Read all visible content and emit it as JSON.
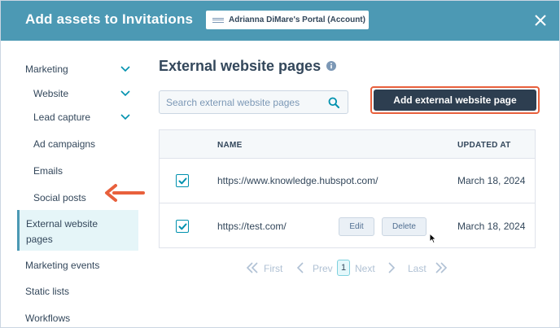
{
  "header": {
    "title": "Add assets to Invitations",
    "account": "Adrianna DiMare's Portal (Account)"
  },
  "sidebar": {
    "items": [
      {
        "label": "Marketing",
        "expanded": true
      },
      {
        "label": "Website"
      },
      {
        "label": "Lead capture"
      },
      {
        "label": "Ad campaigns"
      },
      {
        "label": "Emails"
      },
      {
        "label": "Social posts"
      },
      {
        "label_line1": "External website",
        "label_line2": "pages",
        "active": true
      },
      {
        "label": "Marketing events"
      },
      {
        "label": "Static lists"
      },
      {
        "label": "Workflows"
      }
    ]
  },
  "main": {
    "title": "External website pages",
    "search_placeholder": "Search external website pages",
    "add_button": "Add external website page"
  },
  "table": {
    "columns": [
      "NAME",
      "UPDATED AT"
    ],
    "rows": [
      {
        "name": "https://www.knowledge.hubspot.com/",
        "updated": "March 18, 2024",
        "checked": true
      },
      {
        "name": "https://test.com/",
        "updated": "March 18, 2024",
        "checked": true,
        "edit": "Edit",
        "delete": "Delete"
      }
    ]
  },
  "pagination": {
    "first": "First",
    "prev": "Prev",
    "current": "1",
    "next": "Next",
    "last": "Last"
  },
  "colors": {
    "header_bg": "#4c99b4",
    "primary_dark": "#2d3e50",
    "highlight_orange": "#e8603c",
    "checkbox_teal": "#0091ae",
    "active_bg": "#e5f5f8"
  }
}
